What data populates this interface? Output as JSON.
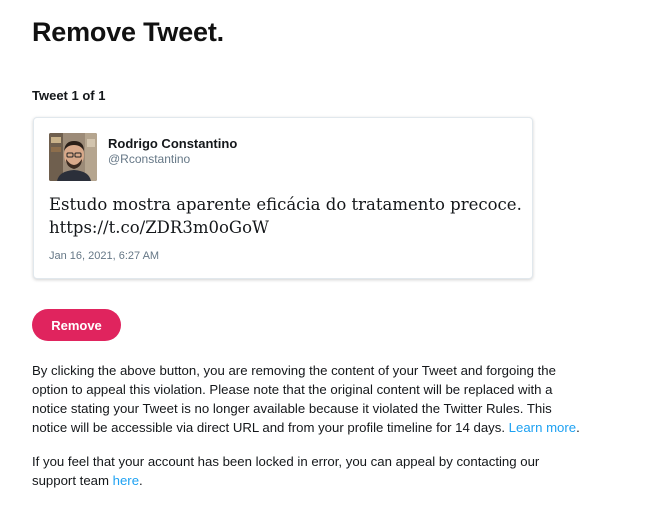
{
  "page": {
    "title": "Remove Tweet.",
    "counter": "Tweet 1 of 1"
  },
  "tweet": {
    "author_name": "Rodrigo Constantino",
    "author_handle": "@Rconstantino",
    "text_lines": [
      "Estudo mostra aparente eficácia do tratamento precoce.",
      "https://t.co/ZDR3m0oGoW"
    ],
    "date": "Jan 16, 2021, 6:27 AM",
    "avatar_icon": "user-avatar-photo"
  },
  "actions": {
    "remove_label": "Remove",
    "remove_color": "#e0245e"
  },
  "notice": {
    "lines": [
      "By clicking the above button, you are removing the content of your Tweet and forgoing the",
      "option to appeal this violation. Please note that the original content will be replaced with a",
      "notice stating your Tweet is no longer available because it violated the Twitter Rules. This",
      "notice will be accessible via direct URL and from your profile timeline for 14 days. "
    ],
    "learn_more_link": "Learn more",
    "learn_more_suffix": "."
  },
  "appeal": {
    "line1": "If you feel that your account has been locked in error, you can appeal by contacting our",
    "line2_prefix": "support team ",
    "here_link": "here",
    "line2_suffix": "."
  },
  "colors": {
    "link": "#1da1f2",
    "secondary_text": "#657786"
  }
}
